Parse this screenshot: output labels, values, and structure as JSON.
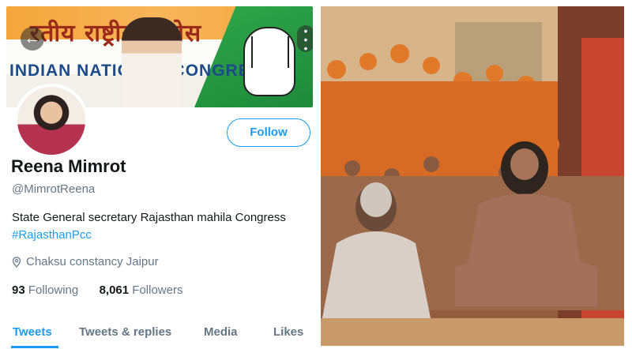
{
  "profile": {
    "banner": {
      "hindi_text": "रतीय राष्ट्रीय कांग्रेस",
      "english_text": "INDIAN NATIONAL CONGRESS"
    },
    "follow_label": "Follow",
    "name": "Reena Mimrot",
    "handle": "@MimrotReena",
    "bio_text": "State  General secretary Rajasthan mahila Congress",
    "bio_hashtag": "#RajasthanPcc",
    "location": "Chaksu constancy Jaipur",
    "following_count": "93",
    "following_label": "Following",
    "followers_count": "8,061",
    "followers_label": "Followers",
    "tabs": [
      "Tweets",
      "Tweets & replies",
      "Media",
      "Likes"
    ],
    "accent_color": "#1d9bf0"
  },
  "icons": {
    "back": "arrow-left-icon",
    "more": "more-vertical-icon",
    "location": "location-pin-icon"
  }
}
